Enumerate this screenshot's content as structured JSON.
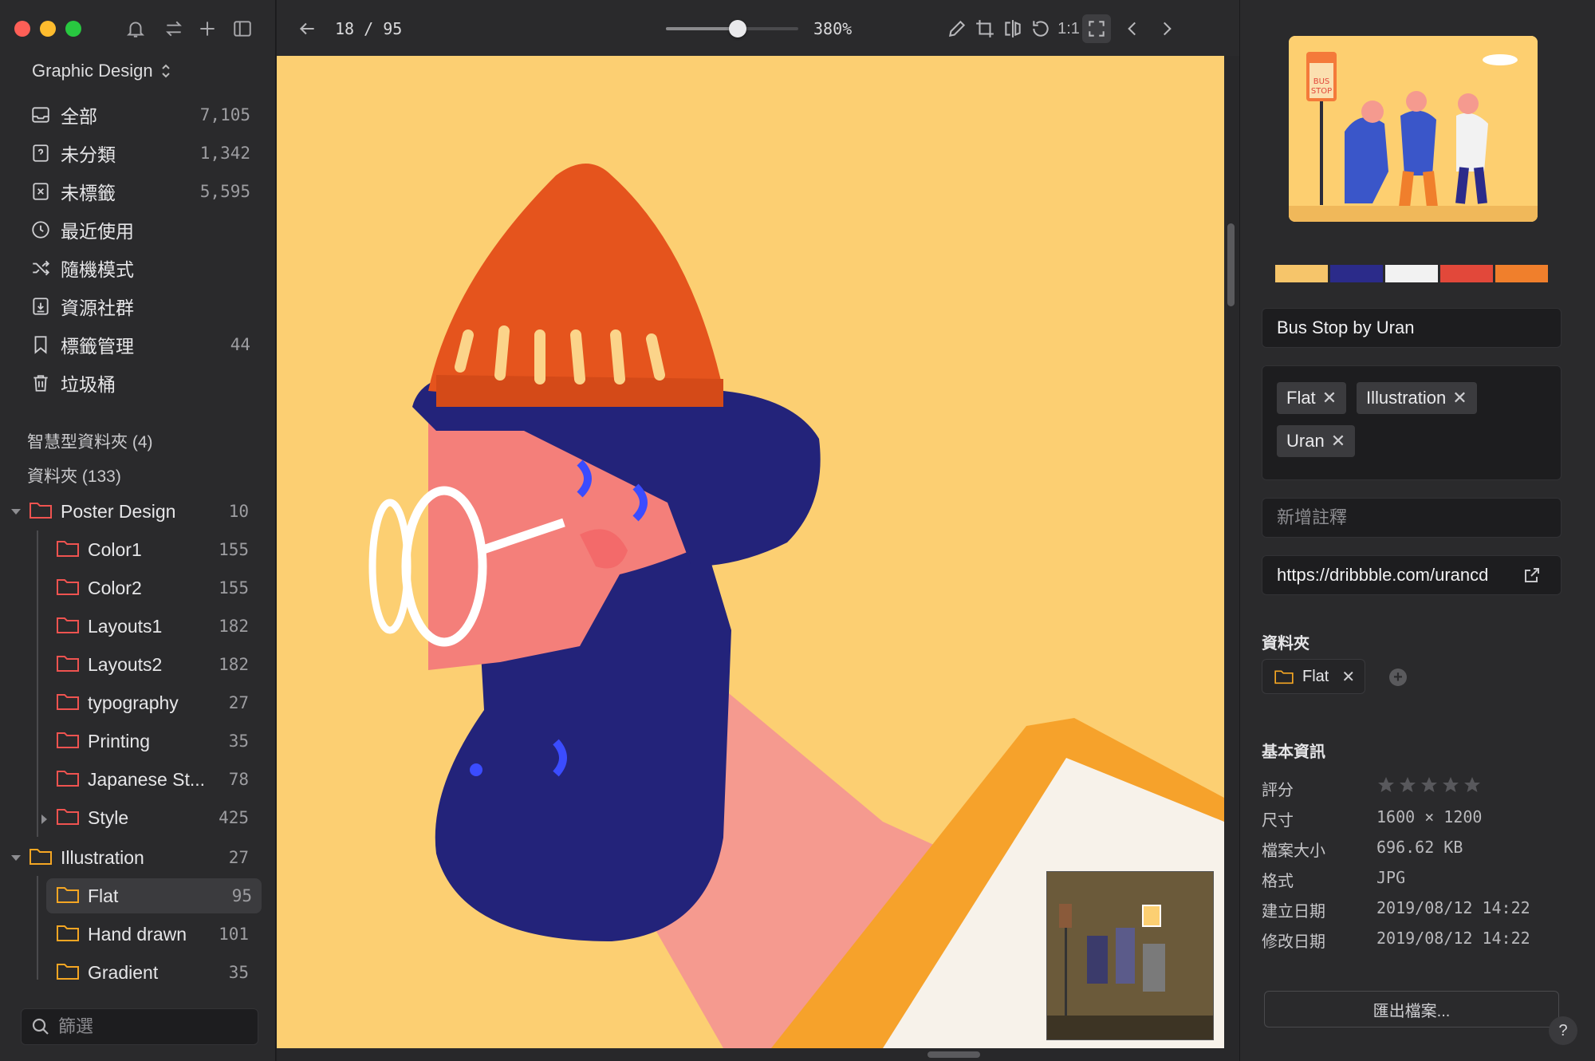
{
  "toolbar": {
    "page_indicator": "18 / 95",
    "zoom_label": "380%",
    "zoom_fraction": 0.54,
    "one_to_one_label": "1:1"
  },
  "sidebar": {
    "library": "Graphic Design",
    "nav": [
      {
        "label": "全部",
        "count": "7,105",
        "icon": "inbox-icon"
      },
      {
        "label": "未分類",
        "count": "1,342",
        "icon": "question-box-icon"
      },
      {
        "label": "未標籤",
        "count": "5,595",
        "icon": "untagged-icon"
      },
      {
        "label": "最近使用",
        "count": "",
        "icon": "clock-icon"
      },
      {
        "label": "隨機模式",
        "count": "",
        "icon": "shuffle-icon"
      },
      {
        "label": "資源社群",
        "count": "",
        "icon": "download-box-icon"
      },
      {
        "label": "標籤管理",
        "count": "44",
        "icon": "bookmark-icon"
      },
      {
        "label": "垃圾桶",
        "count": "",
        "icon": "trash-icon"
      }
    ],
    "smart_folders_label": "智慧型資料夾 (4)",
    "folders_label": "資料夾 (133)",
    "folders": [
      {
        "label": "Poster Design",
        "count": "10"
      },
      {
        "label": "Color1",
        "count": "155"
      },
      {
        "label": "Color2",
        "count": "155"
      },
      {
        "label": "Layouts1",
        "count": "182"
      },
      {
        "label": "Layouts2",
        "count": "182"
      },
      {
        "label": "typography",
        "count": "27"
      },
      {
        "label": "Printing",
        "count": "35"
      },
      {
        "label": "Japanese St...",
        "count": "78"
      },
      {
        "label": "Style",
        "count": "425"
      },
      {
        "label": "Illustration",
        "count": "27"
      },
      {
        "label": "Flat",
        "count": "95"
      },
      {
        "label": "Hand drawn",
        "count": "101"
      },
      {
        "label": "Gradient",
        "count": "35"
      }
    ],
    "filter_placeholder": "篩選"
  },
  "inspector": {
    "thumb_sign": [
      "BUS",
      "STOP"
    ],
    "palette": [
      "#f6c56a",
      "#2b2b8a",
      "#f2f2f2",
      "#e2483a",
      "#f07f2c"
    ],
    "title": "Bus Stop by Uran",
    "tags": [
      "Flat",
      "Illustration",
      "Uran"
    ],
    "tag_remove": "✕",
    "note_placeholder": "新增註釋",
    "url": "https://dribbble.com/urancd",
    "folder_section": "資料夾",
    "folder_chip": "Flat",
    "basic_info_section": "基本資訊",
    "rating": 0,
    "rating_max": 5,
    "meta": [
      {
        "key": "評分",
        "value": ""
      },
      {
        "key": "尺寸",
        "value": "1600 × 1200"
      },
      {
        "key": "檔案大小",
        "value": "696.62 KB"
      },
      {
        "key": "格式",
        "value": "JPG"
      },
      {
        "key": "建立日期",
        "value": "2019/08/12 14:22"
      },
      {
        "key": "修改日期",
        "value": "2019/08/12 14:22"
      }
    ],
    "export_label": "匯出檔案...",
    "help_label": "?"
  }
}
